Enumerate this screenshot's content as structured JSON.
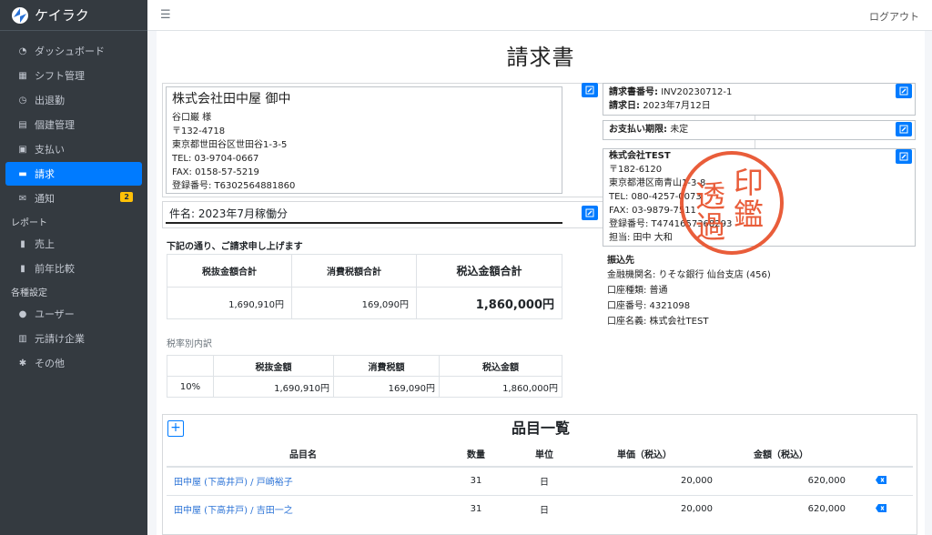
{
  "app": {
    "name": "ケイラク"
  },
  "sidebar": {
    "items": [
      {
        "label": "ダッシュボード",
        "icon": "dashboard-icon"
      },
      {
        "label": "シフト管理",
        "icon": "calendar-icon"
      },
      {
        "label": "出退勤",
        "icon": "clock-icon"
      },
      {
        "label": "個建管理",
        "icon": "building-icon"
      },
      {
        "label": "支払い",
        "icon": "money-icon"
      },
      {
        "label": "請求",
        "icon": "invoice-icon",
        "active": true
      },
      {
        "label": "通知",
        "icon": "envelope-icon",
        "badge": "2"
      }
    ],
    "report_header": "レポート",
    "report_items": [
      {
        "label": "売上",
        "icon": "bar-chart-icon"
      },
      {
        "label": "前年比較",
        "icon": "bar-chart-icon"
      }
    ],
    "settings_header": "各種設定",
    "settings_items": [
      {
        "label": "ユーザー",
        "icon": "user-icon"
      },
      {
        "label": "元請け企業",
        "icon": "company-icon"
      },
      {
        "label": "その他",
        "icon": "gear-icon"
      }
    ]
  },
  "topbar": {
    "logout": "ログアウト"
  },
  "page": {
    "title": "請求書"
  },
  "recipient": {
    "name": "株式会社田中屋 御中",
    "person": "谷口巌 様",
    "postal": "〒132-4718",
    "address": "東京都世田谷区世田谷1-3-5",
    "tel": "TEL: 03-9704-0667",
    "fax": "FAX: 0158-57-5219",
    "reg": "登録番号: T6302564881860"
  },
  "subject": "件名: 2023年7月稼働分",
  "intro": "下記の通り、ご請求申し上げます",
  "summary": {
    "headers": [
      "税抜金額合計",
      "消費税額合計",
      "税込金額合計"
    ],
    "values": [
      "1,690,910円",
      "169,090円",
      "1,860,000円"
    ]
  },
  "breakdown": {
    "title": "税率別内訳",
    "headers": [
      "",
      "税抜金額",
      "消費税額",
      "税込金額"
    ],
    "row": [
      "10%",
      "1,690,910円",
      "169,090円",
      "1,860,000円"
    ]
  },
  "invoice_meta": {
    "number_label": "請求書番号:",
    "number": "INV20230712-1",
    "date_label": "請求日:",
    "date": "2023年7月12日"
  },
  "due": {
    "label": "お支払い期限:",
    "value": "未定"
  },
  "issuer": {
    "name": "株式会社TEST",
    "postal": "〒182-6120",
    "address": "東京都港区南青山1-3-8",
    "tel": "TEL: 080-4257-0073",
    "fax": "FAX: 03-9879-7511",
    "reg": "登録番号: T4741657368293",
    "person": "担当: 田中 大和"
  },
  "stamp": {
    "chars": [
      "印",
      "透",
      "鑑",
      "過"
    ],
    "color": "#e8502a"
  },
  "bank": {
    "title": "振込先",
    "bank": "金融機関名: りそな銀行 仙台支店 (456)",
    "type": "口座種類: 普通",
    "number": "口座番号: 4321098",
    "holder": "口座名義: 株式会社TEST"
  },
  "items": {
    "title": "品目一覧",
    "add_label": "+",
    "headers": [
      "品目名",
      "数量",
      "単位",
      "単価（税込）",
      "金額（税込）"
    ],
    "rows": [
      {
        "name": "田中屋 (下高井戸) / 戸崎裕子",
        "qty": "31",
        "unit": "日",
        "price": "20,000",
        "amount": "620,000"
      },
      {
        "name": "田中屋 (下高井戸) / 吉田一之",
        "qty": "31",
        "unit": "日",
        "price": "20,000",
        "amount": "620,000"
      }
    ]
  },
  "colors": {
    "accent": "#007bff",
    "sidebar": "#343a40",
    "badge": "#ffc107",
    "stamp": "#e8502a"
  }
}
